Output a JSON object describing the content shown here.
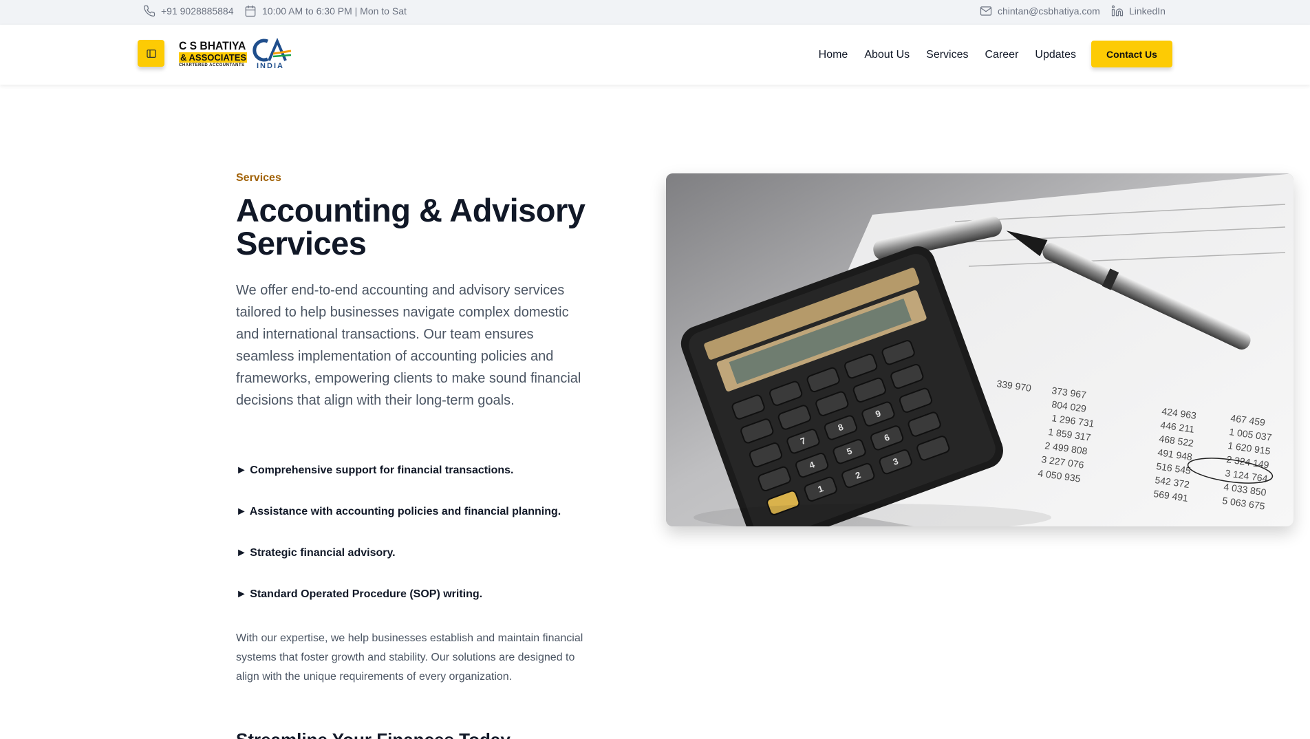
{
  "topbar": {
    "phone": "+91 9028885884",
    "hours": "10:00 AM to 6:30 PM | Mon to Sat",
    "email": "chintan@csbhatiya.com",
    "linkedin": "LinkedIn"
  },
  "header": {
    "logo": {
      "line1": "C S BHATIYA",
      "line2": "& ASSOCIATES",
      "line3": "CHARTERED ACCOUNTANTS",
      "india": "INDIA"
    },
    "nav": [
      "Home",
      "About Us",
      "Services",
      "Career",
      "Updates"
    ],
    "contact_button": "Contact Us"
  },
  "main": {
    "eyebrow": "Services",
    "title": "Accounting & Advisory Services",
    "intro": "We offer end-to-end accounting and advisory services tailored to help businesses navigate complex domestic and international transactions. Our team ensures seamless implementation of accounting policies and frameworks, empowering clients to make sound financial decisions that align with their long-term goals.",
    "bullets": [
      "► Comprehensive support for financial transactions.",
      "► Assistance with accounting policies and financial planning.",
      "► Strategic financial advisory.",
      "► Standard Operated Procedure (SOP) writing."
    ],
    "outro": "With our expertise, we help businesses establish and maintain financial systems that foster growth and stability. Our solutions are designed to align with the unique requirements of every organization.",
    "subheading": "Streamline Your Finances Today"
  },
  "colors": {
    "accent": "#fdcb04",
    "eyebrow": "#a16207",
    "topbar_bg": "#f1f3f6"
  }
}
